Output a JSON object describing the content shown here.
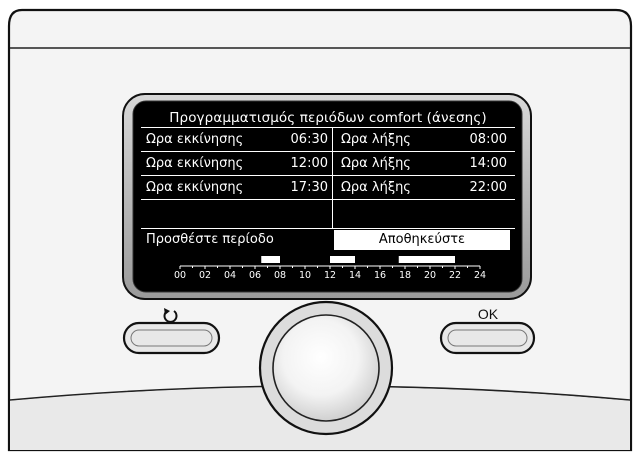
{
  "screen": {
    "title": "Προγραμματισμός περιόδων comfort (άνεσης)",
    "periods": [
      {
        "start_label": "Ωρα εκκίνησης",
        "start_time": "06:30",
        "end_label": "Ωρα λήξης",
        "end_time": "08:00"
      },
      {
        "start_label": "Ωρα εκκίνησης",
        "start_time": "12:00",
        "end_label": "Ωρα λήξης",
        "end_time": "14:00"
      },
      {
        "start_label": "Ωρα εκκίνησης",
        "start_time": "17:30",
        "end_label": "Ωρα λήξης",
        "end_time": "22:00"
      }
    ],
    "add_period_label": "Προσθέστε περίοδο",
    "save_label": "Αποθηκεύστε",
    "timeline": {
      "hour_labels": [
        "00",
        "02",
        "04",
        "06",
        "08",
        "10",
        "12",
        "14",
        "16",
        "18",
        "20",
        "22",
        "24"
      ],
      "comfort_blocks_hours": [
        [
          6.5,
          8
        ],
        [
          12,
          14
        ],
        [
          17.5,
          22
        ]
      ]
    }
  },
  "buttons": {
    "back_icon": "back-arrow-icon",
    "ok_label": "OK"
  },
  "colors": {
    "screen_bg": "#000000",
    "screen_text": "#ffffff",
    "device_body": "#f2f2f2"
  }
}
